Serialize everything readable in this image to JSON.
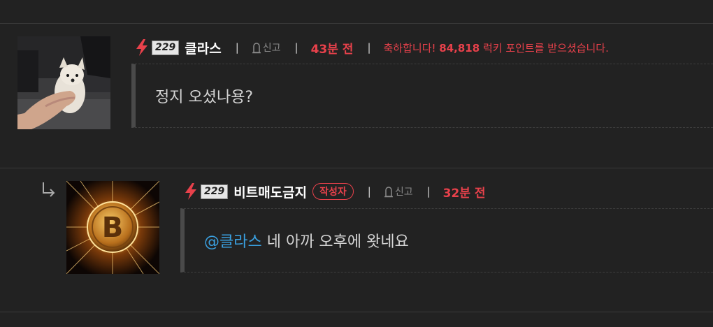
{
  "comments": [
    {
      "level": "229",
      "nickname": "클라스",
      "report_label": "신고",
      "time": "43분 전",
      "lucky": {
        "prefix": "축하합니다! ",
        "points": "84,818",
        "suffix": " 럭키 포인트를 받으셨습니다."
      },
      "body": "정지 오셨나용?"
    },
    {
      "level": "229",
      "nickname": "비트매도금지",
      "author_badge": "작성자",
      "report_label": "신고",
      "time": "32분 전",
      "mention": "@클라스",
      "body": " 네 아까 오후에 왓네요"
    }
  ],
  "colors": {
    "background": "#222222",
    "accent_red": "#e8414b",
    "mention_blue": "#3aa0e0"
  },
  "icons": [
    "lightning-icon",
    "report-icon",
    "reply-arrow-icon"
  ]
}
